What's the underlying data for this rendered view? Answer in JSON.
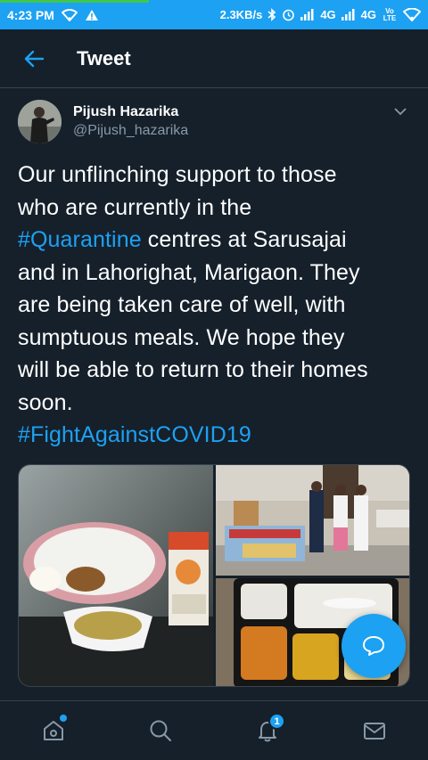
{
  "statusbar": {
    "time": "4:23 PM",
    "speed": "2.3KB/s",
    "net1": "4G",
    "net2": "4G",
    "volte": "Vo LTE"
  },
  "header": {
    "title": "Tweet"
  },
  "tweet": {
    "author_name": "Pijush Hazarika",
    "author_handle": "@Pijush_hazarika",
    "lines": [
      "Our unflinching support to those",
      "who are currently in the",
      "#Quarantine",
      " centres at Sarusajai",
      "and  in Lahorighat,  Marigaon. They",
      "are being taken care of well, with",
      "sumptuous meals. We hope they",
      "will be able to return to their homes",
      "soon.",
      "#FightAgainstCOVID19"
    ]
  },
  "nav": {
    "notification_count": "1"
  },
  "colors": {
    "background": "#15202b",
    "accent": "#1da1f2",
    "muted": "#8899a6",
    "divider": "#38444d"
  }
}
